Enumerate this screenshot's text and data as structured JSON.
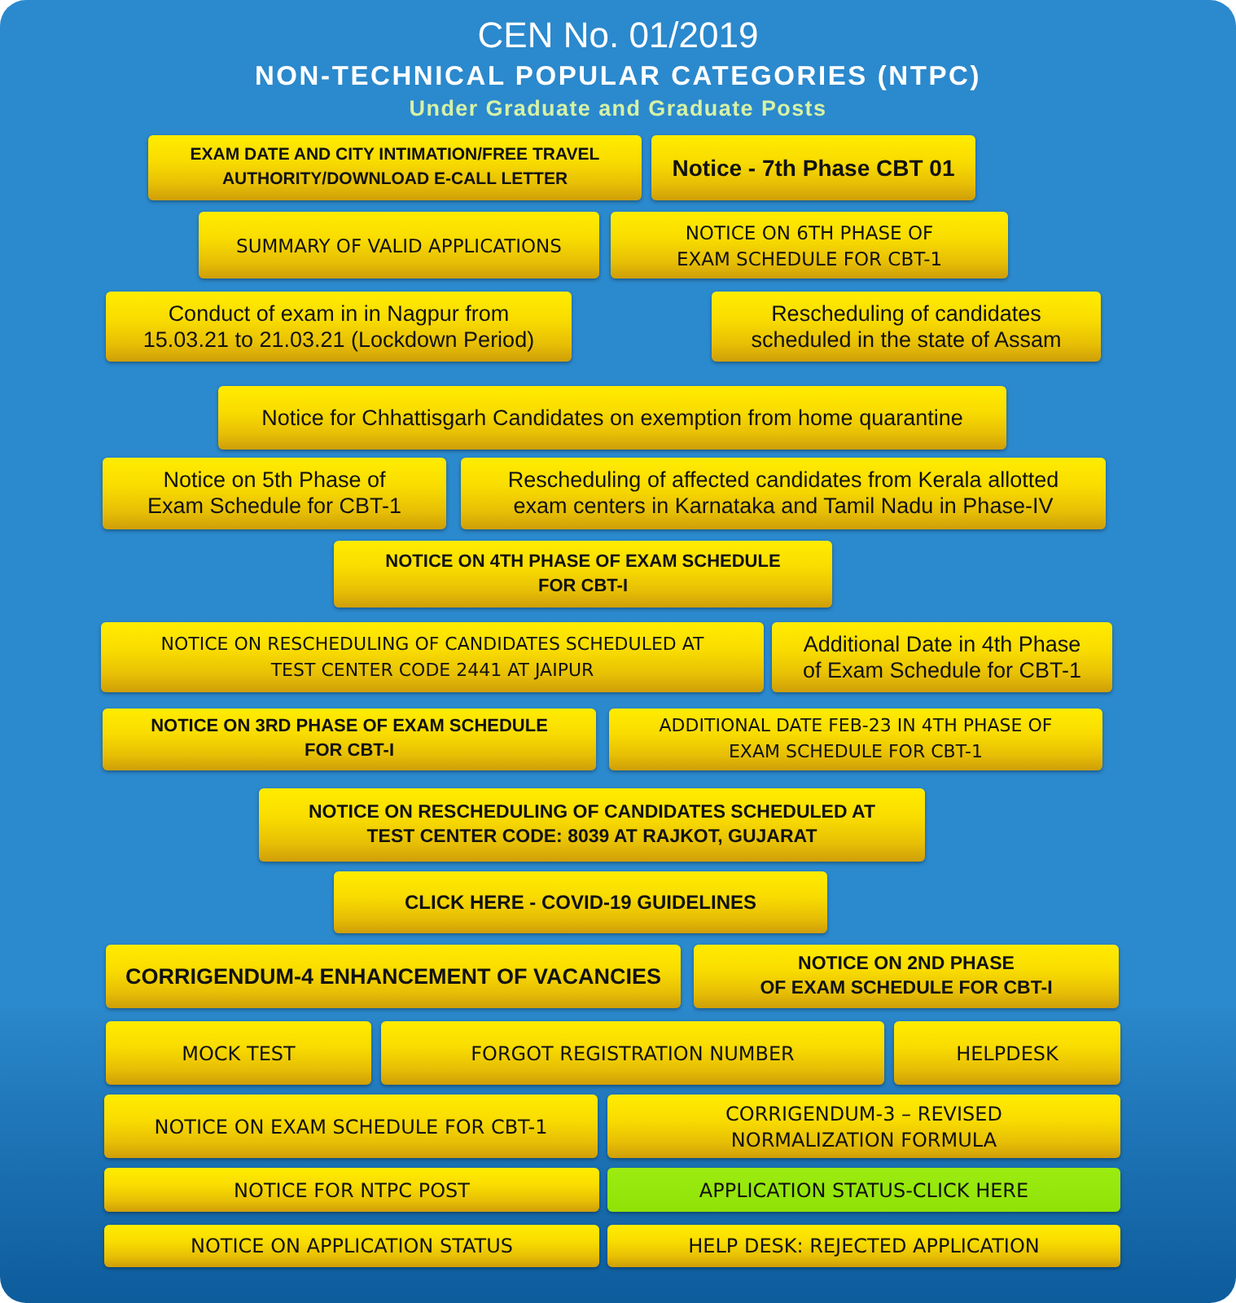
{
  "header": {
    "title": "CEN No. 01/2019",
    "subtitle": "NON-TECHNICAL POPULAR CATEGORIES (NTPC)",
    "tagline": "Under Graduate and Graduate Posts"
  },
  "rows": [
    {
      "buttons": [
        {
          "lines": [
            "EXAM DATE AND CITY INTIMATION/FREE TRAVEL",
            "AUTHORITY/DOWNLOAD E-CALL LETTER"
          ],
          "highlighted": false
        },
        {
          "lines": [
            "Notice - 7th Phase CBT 01"
          ],
          "highlighted": false
        }
      ]
    },
    {
      "buttons": [
        {
          "lines": [
            "SUMMARY OF VALID APPLICATIONS"
          ],
          "highlighted": false
        },
        {
          "lines": [
            "NOTICE ON 6TH PHASE OF",
            "EXAM SCHEDULE FOR CBT-1"
          ],
          "highlighted": false
        }
      ]
    },
    {
      "buttons": [
        {
          "lines": [
            "Conduct of exam in in Nagpur from",
            "15.03.21 to 21.03.21 (Lockdown Period)"
          ],
          "highlighted": false
        },
        {
          "lines": [
            "Rescheduling of candidates",
            "scheduled in the state of Assam"
          ],
          "highlighted": false
        }
      ]
    },
    {
      "buttons": [
        {
          "lines": [
            "Notice for Chhattisgarh Candidates on exemption from home quarantine"
          ],
          "highlighted": false
        }
      ]
    },
    {
      "buttons": [
        {
          "lines": [
            "Notice on 5th Phase of",
            "Exam Schedule for CBT-1"
          ],
          "highlighted": false
        },
        {
          "lines": [
            "Rescheduling of affected candidates from Kerala allotted",
            "exam centers in Karnataka and Tamil Nadu in Phase-IV"
          ],
          "highlighted": false
        }
      ]
    },
    {
      "buttons": [
        {
          "lines": [
            "NOTICE ON 4TH PHASE OF EXAM SCHEDULE",
            "FOR CBT-I"
          ],
          "highlighted": false
        }
      ]
    },
    {
      "buttons": [
        {
          "lines": [
            "NOTICE ON RESCHEDULING OF CANDIDATES SCHEDULED AT",
            "TEST CENTER CODE 2441 AT JAIPUR"
          ],
          "highlighted": false
        },
        {
          "lines": [
            "Additional Date in 4th Phase",
            "of Exam Schedule for CBT-1"
          ],
          "highlighted": false
        }
      ]
    },
    {
      "buttons": [
        {
          "lines": [
            "NOTICE ON 3RD PHASE OF EXAM SCHEDULE",
            "FOR CBT-I"
          ],
          "highlighted": false
        },
        {
          "lines": [
            "ADDITIONAL DATE FEB-23 IN 4TH PHASE OF",
            "EXAM SCHEDULE FOR CBT-1"
          ],
          "highlighted": false
        }
      ]
    },
    {
      "buttons": [
        {
          "lines": [
            "NOTICE ON RESCHEDULING OF CANDIDATES SCHEDULED AT",
            "TEST CENTER CODE: 8039 AT RAJKOT, GUJARAT"
          ],
          "highlighted": false
        }
      ]
    },
    {
      "buttons": [
        {
          "lines": [
            "CLICK HERE - COVID-19 GUIDELINES"
          ],
          "highlighted": false
        }
      ]
    },
    {
      "buttons": [
        {
          "lines": [
            "CORRIGENDUM-4 ENHANCEMENT OF VACANCIES"
          ],
          "highlighted": false
        },
        {
          "lines": [
            "NOTICE ON 2ND PHASE",
            "OF EXAM SCHEDULE FOR CBT-I"
          ],
          "highlighted": false
        }
      ]
    },
    {
      "buttons": [
        {
          "lines": [
            "MOCK TEST"
          ],
          "highlighted": false
        },
        {
          "lines": [
            "FORGOT REGISTRATION NUMBER"
          ],
          "highlighted": false
        },
        {
          "lines": [
            "HELPDESK"
          ],
          "highlighted": false
        }
      ]
    },
    {
      "buttons": [
        {
          "lines": [
            "NOTICE ON EXAM SCHEDULE FOR CBT-1"
          ],
          "highlighted": false
        },
        {
          "lines": [
            "CORRIGENDUM-3 – REVISED",
            "NORMALIZATION FORMULA"
          ],
          "highlighted": false
        }
      ]
    },
    {
      "buttons": [
        {
          "lines": [
            "NOTICE FOR NTPC POST"
          ],
          "highlighted": false
        },
        {
          "lines": [
            "APPLICATION STATUS-CLICK HERE"
          ],
          "highlighted": true
        }
      ]
    },
    {
      "buttons": [
        {
          "lines": [
            "NOTICE ON APPLICATION STATUS"
          ],
          "highlighted": false
        },
        {
          "lines": [
            "HELP DESK: REJECTED APPLICATION"
          ],
          "highlighted": false
        }
      ]
    }
  ]
}
